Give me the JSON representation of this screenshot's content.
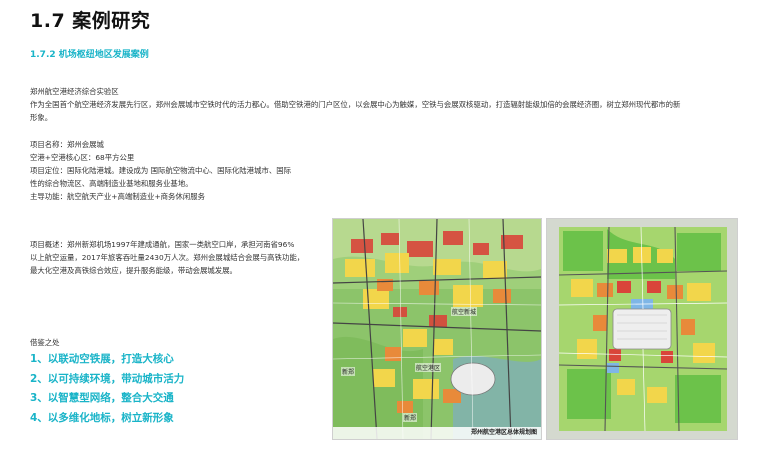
{
  "header": {
    "title": "1.7 案例研究",
    "subtitle": "1.7.2 机场枢纽地区发展案例"
  },
  "intro": {
    "heading": "郑州航空港经济综合实验区",
    "line1": "作为全国首个航空港经济发展先行区，郑州会展城市空铁时代的活力都心。借助空铁港的门户区位，以会展中心为触媒，空铁与会展双核驱动，打造辐射能级加倍的会展经济圈，树立郑州现代都市的新",
    "line2": "形象。"
  },
  "project_info": {
    "name": "项目名称：郑州会展城",
    "area": "空港+空港核心区：68平方公里",
    "positioning_1": "项目定位：国际化陆港城。建设成为 国际航空物流中心、国际化陆港城市、国际",
    "positioning_2": "性的综合物流区、高端制造业基地和服务业基地。",
    "function": "主导功能：航空航天产业+高端制造业+商务休闲服务"
  },
  "overview": {
    "line1": "项目概述：郑州新郑机场1997年建成通航，国家一类航空口岸，承担河南省96%",
    "line2": "以上航空运量，2017年旅客吞吐量2430万人次。郑州会展城结合会展与高铁功能，",
    "line3": "最大化空港及高铁综合效应，提升服务能级，带动会展城发展。"
  },
  "reference": {
    "title": "借鉴之处",
    "points": [
      "1、以联动空铁展，打造大核心",
      "2、以可持续环境，带动城市活力",
      "3、以智慧型网络，整合大交通",
      "4、以多维化地标，树立新形象"
    ]
  },
  "maps": {
    "left": {
      "caption": "郑州航空港区总体规划图",
      "labels": [
        "航空新城",
        "航空港区",
        "新郑",
        "新郑"
      ]
    },
    "right": {}
  },
  "colors": {
    "accent": "#19b4c8",
    "map_green": "#6cc24a",
    "map_yellow": "#f2d64b",
    "map_orange": "#e88a3a",
    "map_red": "#d9453a",
    "map_blue": "#7fb6e6"
  }
}
